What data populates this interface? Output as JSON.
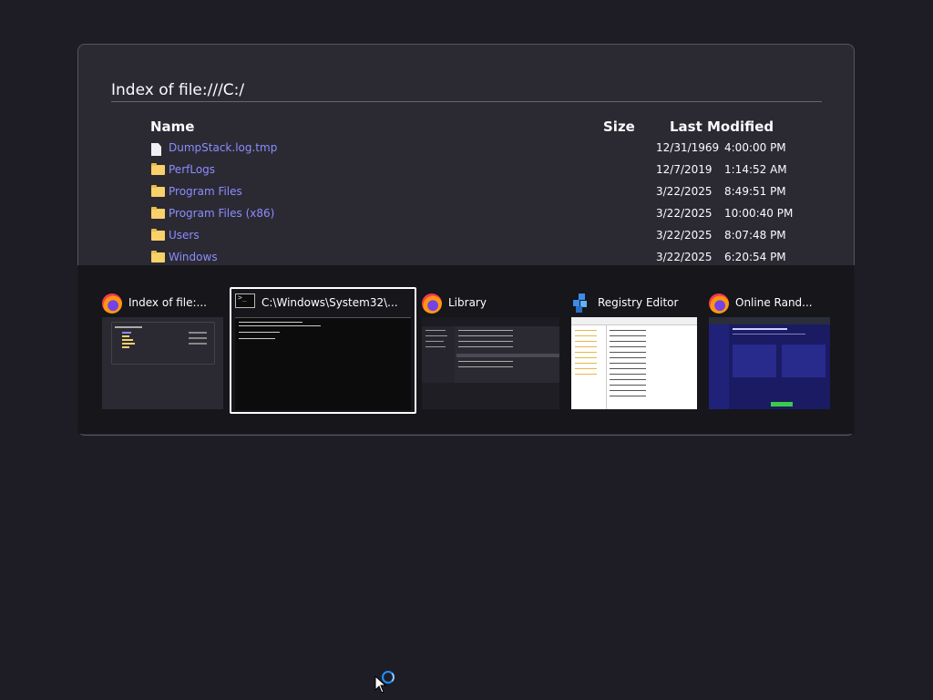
{
  "listing": {
    "title": "Index of file:///C:/",
    "headers": {
      "name": "Name",
      "size": "Size",
      "modified": "Last Modified"
    },
    "rows": [
      {
        "icon": "file-icon",
        "name": "DumpStack.log.tmp",
        "date": "12/31/1969",
        "time": "4:00:00 PM"
      },
      {
        "icon": "folder-icon",
        "name": "PerfLogs",
        "date": "12/7/2019",
        "time": "1:14:52 AM"
      },
      {
        "icon": "folder-icon",
        "name": "Program Files",
        "date": "3/22/2025",
        "time": "8:49:51 PM"
      },
      {
        "icon": "folder-icon",
        "name": "Program Files (x86)",
        "date": "3/22/2025",
        "time": "10:00:40 PM"
      },
      {
        "icon": "folder-icon",
        "name": "Users",
        "date": "3/22/2025",
        "time": "8:07:48 PM"
      },
      {
        "icon": "folder-icon",
        "name": "Windows",
        "date": "3/22/2025",
        "time": "6:20:54 PM"
      }
    ]
  },
  "switcher": {
    "tasks": [
      {
        "app_icon": "firefox-icon",
        "label": "Index of file:...",
        "selected": false
      },
      {
        "app_icon": "command-prompt-icon",
        "label": "C:\\Windows\\System32\\...",
        "selected": true
      },
      {
        "app_icon": "firefox-icon",
        "label": "Library",
        "selected": false
      },
      {
        "app_icon": "registry-editor-icon",
        "label": "Registry Editor",
        "selected": false
      },
      {
        "app_icon": "firefox-icon",
        "label": "Online Rand...",
        "selected": false
      }
    ]
  },
  "colors": {
    "desktop": "#1e1d25",
    "link": "#8c8cff",
    "switcher_bg": "#151519",
    "selection_border": "#ffffff",
    "busy_indicator": "#1f8fff"
  }
}
